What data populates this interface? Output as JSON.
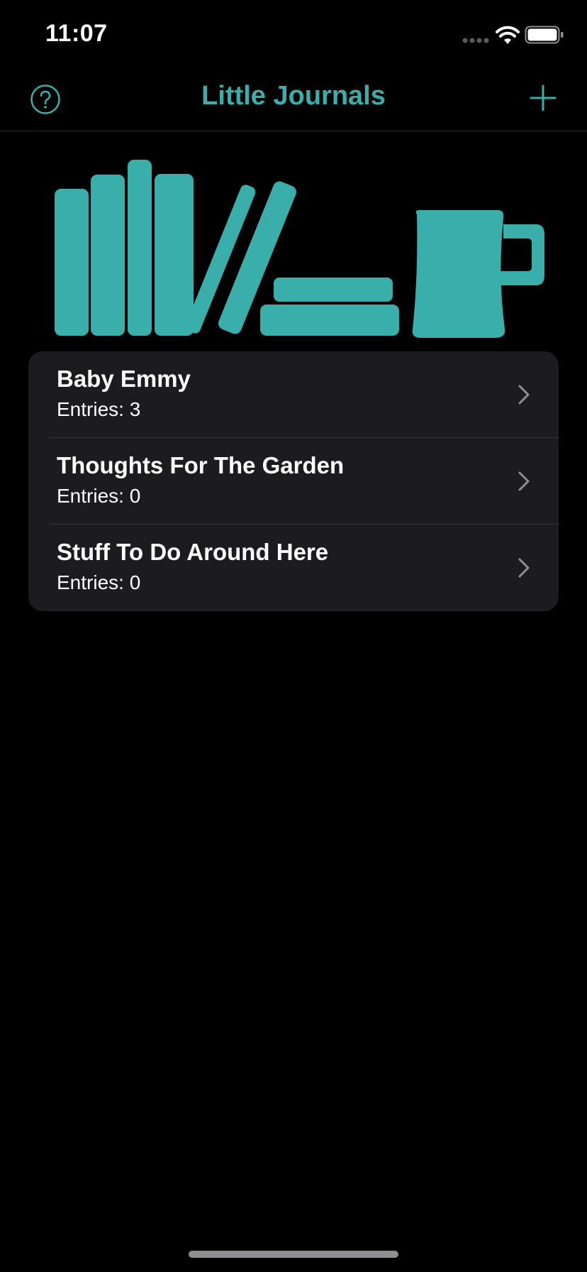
{
  "status_bar": {
    "time": "11:07"
  },
  "nav": {
    "title": "Little Journals",
    "left_icon": "help-circle-icon",
    "right_icon": "plus-icon"
  },
  "colors": {
    "accent": "#3aaeaa",
    "background": "#000000",
    "card": "#1c1c1e",
    "separator": "#38383a",
    "chevron": "#8e8e93"
  },
  "hero": {
    "icon": "bookshelf-with-mug-illustration"
  },
  "journals": [
    {
      "title": "Baby Emmy",
      "entries": "Entries: 3"
    },
    {
      "title": "Thoughts For The Garden",
      "entries": "Entries: 0"
    },
    {
      "title": "Stuff To Do Around Here",
      "entries": "Entries: 0"
    }
  ]
}
